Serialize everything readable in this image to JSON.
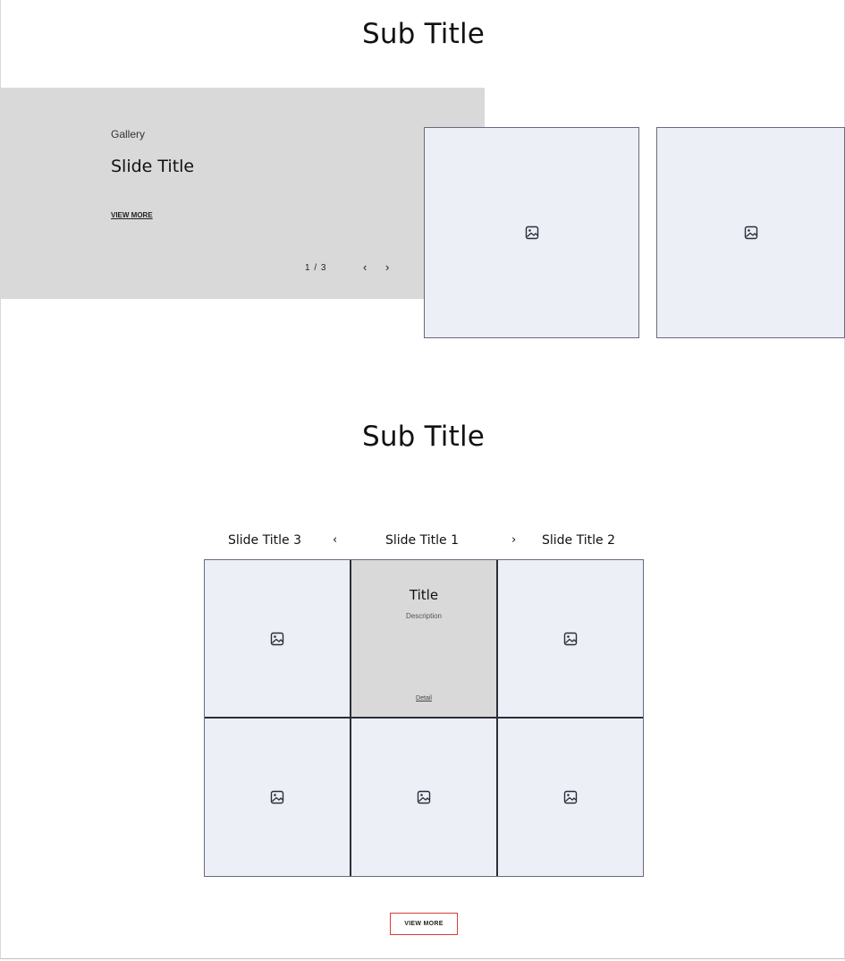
{
  "section1": {
    "sub_title": "Sub Title",
    "gallery": {
      "eyebrow": "Gallery",
      "slide_title": "Slide Title",
      "view_more": "VIEW MORE",
      "pager": "1 / 3",
      "prev_arrow": "‹",
      "next_arrow": "›"
    },
    "image_cards": [
      {
        "icon": "image-icon"
      },
      {
        "icon": "image-icon"
      }
    ]
  },
  "section2": {
    "sub_title": "Sub Title",
    "tabs": {
      "left": "Slide Title 3",
      "prev_arrow": "‹",
      "center": "Slide Title 1",
      "next_arrow": "›",
      "right": "Slide Title 2"
    },
    "active_card": {
      "title": "Title",
      "description": "Description",
      "detail": "Detail"
    },
    "grid_icons": "image-icon",
    "view_more_button": "VIEW MORE"
  },
  "colors": {
    "panel_gray": "#d9d9d9",
    "card_bg": "#eceff6",
    "card_border": "#686a7e",
    "button_border": "#e03a3a"
  }
}
